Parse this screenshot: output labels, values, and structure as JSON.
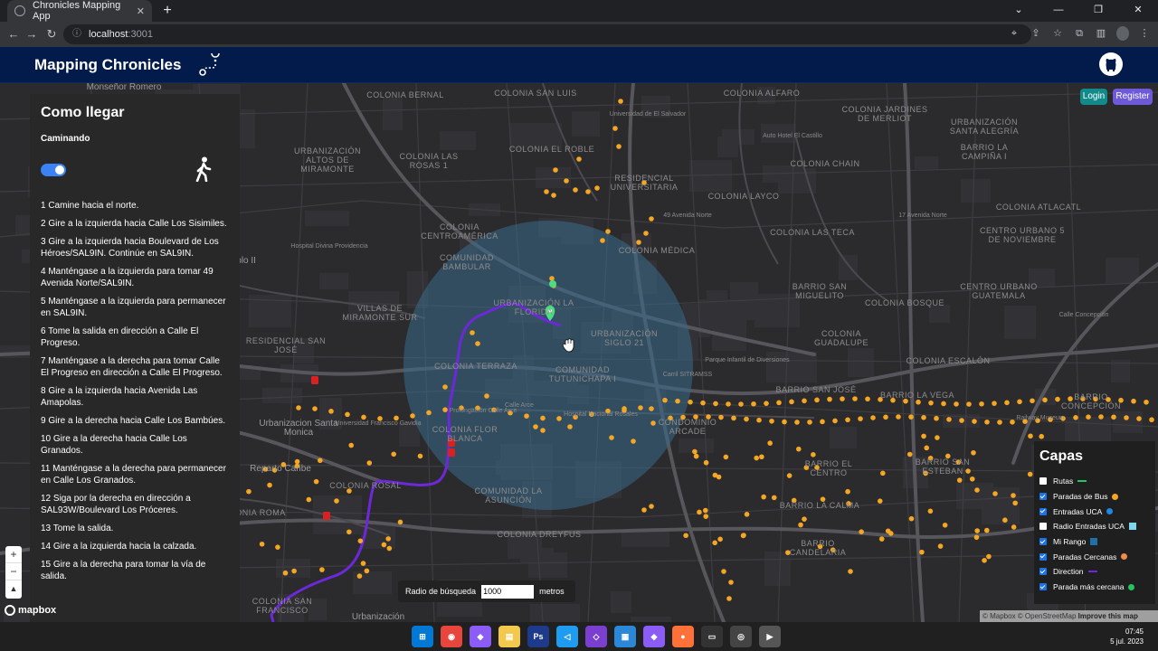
{
  "browser": {
    "tab_title": "Chronicles Mapping App",
    "tab_close": "✕",
    "new_tab": "+",
    "url_host": "localhost",
    "url_port": ":3001",
    "window_buttons": [
      "⌄",
      "—",
      "❐",
      "✕"
    ]
  },
  "app": {
    "title": "Mapping Chronicles",
    "login_label": "Login",
    "register_label": "Register"
  },
  "panel": {
    "title": "Como llegar",
    "mode": "Caminando",
    "walking_enabled": true,
    "steps": [
      "1 Camine hacia el norte.",
      "2 Gire a la izquierda hacia Calle Los Sisimiles.",
      "3 Gire a la izquierda hacia Boulevard de Los Héroes/SAL9IN. Continúe en SAL9IN.",
      "4 Manténgase a la izquierda para tomar 49 Avenida Norte/SAL9IN.",
      "5 Manténgase a la izquierda para permanecer en SAL9IN.",
      "6 Tome la salida en dirección a Calle El Progreso.",
      "7 Manténgase a la derecha para tomar Calle El Progreso en dirección a Calle El Progreso.",
      "8 Gire a la izquierda hacia Avenida Las Amapolas.",
      "9 Gire a la derecha hacia Calle Los Bambúes.",
      "10 Gire a la derecha hacia Calle Los Granados.",
      "11 Manténgase a la derecha para permanecer en Calle Los Granados.",
      "12 Siga por la derecha en dirección a SAL93W/Boulevard Los Próceres.",
      "13 Tome la salida.",
      "14 Gire a la izquierda hacia la calzada.",
      "15 Gire a la derecha para tomar la vía de salida."
    ]
  },
  "map_labels": [
    "Monseñor Romero",
    "COLONIA BERNAL",
    "COLONIA SAN LUIS",
    "Universidad de El Salvador",
    "COLONIA ALFARO",
    "COLONIA JARDINES DE MERLIOT",
    "Auto Hotel El Castillo",
    "URBANIZACIÓN SANTA ALEGRÍA",
    "BARRIO LA CAMPIÑA I",
    "URBANIZACIÓN ALTOS DE MIRAMONTE",
    "COLONIA LAS ROSAS 1",
    "COLONIA EL ROBLE",
    "RESIDENCIAL UNIVERSITARIA",
    "COLONIA CHAIN",
    "COLONIA LAYCO",
    "COLONIA ATLACATL",
    "CENTRO URBANO 5 DE NOVIEMBRE",
    "COLONIA CENTROAMÉRICA",
    "COLONIA LAS TECA",
    "COLONIA MÉDICA",
    "Hospital Divina Providencia",
    "Pablo II",
    "COMUNIDAD BAMBULAR",
    "URBANIZACIÓN LA FLORIDA",
    "VILLAS DE MIRAMONTE SUR",
    "URBANIZACIÓN SIGLO 21",
    "BARRIO SAN MIGUELITO",
    "CENTRO URBANO GUATEMALA",
    "COLONIA BOSQUE",
    "COLONIA GUADALUPE",
    "RESIDENCIAL SAN JOSÉ",
    "COLONIA TERRAZA",
    "COMUNIDAD TUTUNICHAPA I",
    "Parque Infantil de Diversiones",
    "COLONIA ESCALÓN",
    "BARRIO SAN JOSÉ",
    "BARRIO LA VEGA",
    "BARRIO CONCEPCIÓN",
    "Urbanizacion Santa Monica",
    "Universidad Francisco Gavidia",
    "COLONIA FLOR BLANCA",
    "Hospital Nacional Rosales",
    "CONDOMINIO ARCADE",
    "BARRIO EL CENTRO",
    "BARRIO SAN ESTEBAN",
    "Reparto Caribe",
    "COLONIA ROSAL",
    "COMUNIDAD LA ASUNCIÓN",
    "BARRIO LA CALMA",
    "COLONIA ROMA",
    "COLONIA DREYFUS",
    "BARRIO CANDELARIA",
    "COLONIA SAN FRANCISCO",
    "Urbanización",
    "Calle Arce",
    "Prolongación Calle Arce",
    "Carril SITRAMSS",
    "Calle Concepción",
    "49 Avenida Norte",
    "17 Avenida Norte",
    "Railway Museum"
  ],
  "layers": {
    "title": "Capas",
    "items": [
      {
        "label": "Rutas",
        "checked": false,
        "symbol": "line",
        "color": "#22c55e"
      },
      {
        "label": "Paradas de Bus",
        "checked": true,
        "symbol": "dot",
        "color": "#f5a623"
      },
      {
        "label": "Entradas UCA",
        "checked": true,
        "symbol": "dot",
        "color": "#1e88e5"
      },
      {
        "label": "Radio Entradas UCA",
        "checked": false,
        "symbol": "sq",
        "color": "#7fd4f0"
      },
      {
        "label": "Mi Rango",
        "checked": true,
        "symbol": "sq",
        "color": "#1f6fa8"
      },
      {
        "label": "Paradas Cercanas",
        "checked": true,
        "symbol": "dot",
        "color": "#f08c4a"
      },
      {
        "label": "Direction",
        "checked": true,
        "symbol": "line",
        "color": "#6d28d9"
      },
      {
        "label": "Parada más cercana",
        "checked": true,
        "symbol": "dot",
        "color": "#22c55e"
      }
    ]
  },
  "search_radius": {
    "label": "Radio de búsqueda",
    "value": "1000",
    "unit": "metros"
  },
  "map_controls": {
    "zoom_in": "+",
    "zoom_out": "−",
    "compass": "▲",
    "logo": "mapbox",
    "attribution_text": "© Mapbox © OpenStreetMap",
    "attribution_link": "Improve this map"
  },
  "taskbar": {
    "time": "07:45",
    "date": "5 jul. 2023",
    "apps": [
      "windows",
      "chrome",
      "app",
      "explorer",
      "Ps",
      "vscode",
      "visual-studio",
      "calendar",
      "app2",
      "firefox",
      "terminal",
      "obs",
      "media-player"
    ]
  },
  "colors": {
    "header_bg": "#021b4b",
    "map_bg": "#2b2b2e",
    "bus_stop": "#f5a623",
    "route": "#6d28d9",
    "radius_fill": "#3b6a8a",
    "marker": "#4ade80",
    "uca_marker": "#d62222"
  }
}
